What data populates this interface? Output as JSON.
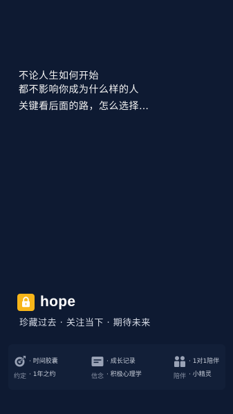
{
  "colors": {
    "background": "#0e1a32",
    "accent": "#f7b519",
    "text_primary": "#ffffff",
    "text_secondary": "#d6dbe6",
    "text_muted": "#8a93a6"
  },
  "quote": {
    "line1": "不论人生如何开始",
    "line2": "都不影响你成为什么样的人",
    "line3": "关键看后面的路，怎么选择…"
  },
  "brand": {
    "logo_icon": "lock-icon",
    "name": "hope",
    "slogan": "珍藏过去 · 关注当下 · 期待未来"
  },
  "features": [
    {
      "icon": "target-check-icon",
      "name": "约定",
      "items": [
        "· 时间胶囊",
        "· 1年之约"
      ]
    },
    {
      "icon": "letter-icon",
      "name": "信念",
      "items": [
        "· 成长记录",
        "· 积极心理学"
      ]
    },
    {
      "icon": "companions-icon",
      "name": "陪伴",
      "items": [
        "· 1对1陪伴",
        "· 小精灵"
      ]
    }
  ]
}
